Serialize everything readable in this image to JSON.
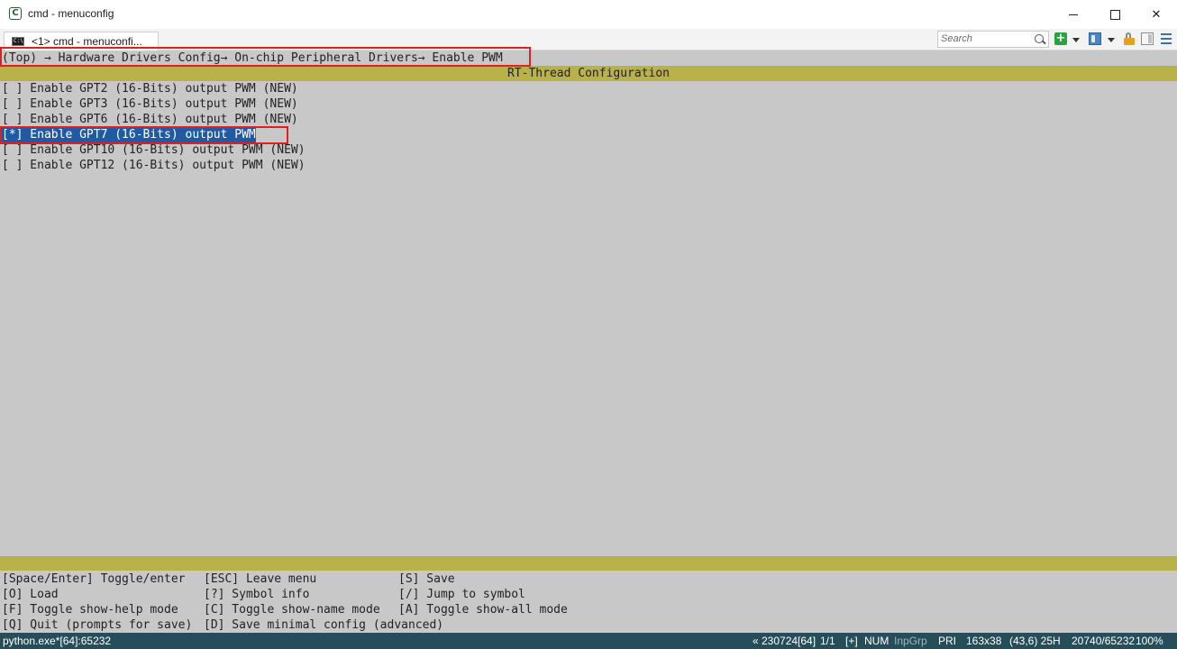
{
  "window": {
    "title": "cmd - menuconfig",
    "app_icon_glyph": "C"
  },
  "tab": {
    "label": "<1> cmd - menuconfi..."
  },
  "search": {
    "placeholder": "Search"
  },
  "terminal": {
    "breadcrumb": "(Top) → Hardware Drivers Config→ On-chip Peripheral Drivers→ Enable PWM",
    "banner_title": "RT-Thread Configuration",
    "items": [
      {
        "label": "[ ] Enable GPT2 (16-Bits) output PWM (NEW)",
        "selected": false
      },
      {
        "label": "[ ] Enable GPT3 (16-Bits) output PWM (NEW)",
        "selected": false
      },
      {
        "label": "[ ] Enable GPT6 (16-Bits) output PWM (NEW)",
        "selected": false
      },
      {
        "label": "[*] Enable GPT7 (16-Bits) output PWM",
        "selected": true
      },
      {
        "label": "[ ] Enable GPT10 (16-Bits) output PWM (NEW)",
        "selected": false
      },
      {
        "label": "[ ] Enable GPT12 (16-Bits) output PWM (NEW)",
        "selected": false
      }
    ],
    "help": {
      "col1": [
        "[Space/Enter] Toggle/enter",
        "[O] Load",
        "[F] Toggle show-help mode",
        "[Q] Quit (prompts for save)"
      ],
      "col2": [
        "[ESC] Leave menu",
        "[?] Symbol info",
        "[C] Toggle show-name mode",
        "[D] Save minimal config (advanced)"
      ],
      "col3": [
        "[S] Save",
        "[/] Jump to symbol",
        "[A] Toggle show-all mode"
      ]
    }
  },
  "statusbar": {
    "process": "python.exe*[64]:65232",
    "build": "« 230724[64]",
    "page": "1/1",
    "plus": "[+]",
    "num": "NUM",
    "inpgrp": "InpGrp",
    "pri": "PRI",
    "size": "163x38",
    "cursor": "(43,6) 25H",
    "memory": "20740/65232",
    "zoom": "100%"
  },
  "colors": {
    "terminal_bg": "#c8c8c8",
    "banner": "#b9b24a",
    "selection": "#1f5aa3",
    "highlight_box": "#e02020",
    "statusbar": "#254e5a"
  }
}
